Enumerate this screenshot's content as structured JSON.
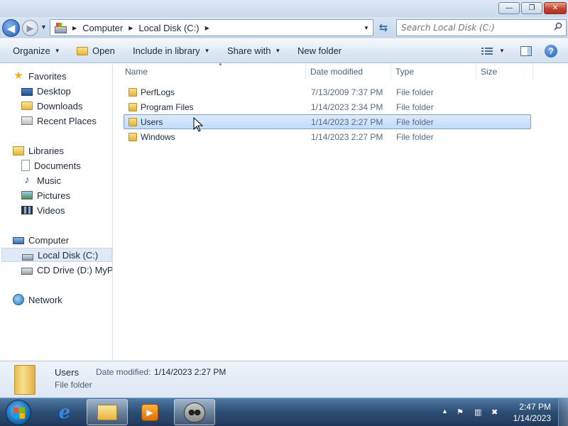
{
  "window": {
    "minimize_label": "—",
    "maximize_label": "❐",
    "close_label": "✕"
  },
  "navbar": {
    "breadcrumbs": [
      "Computer",
      "Local Disk (C:)"
    ],
    "search_placeholder": "Search Local Disk (C:)"
  },
  "toolbar": {
    "organize_label": "Organize",
    "open_label": "Open",
    "include_label": "Include in library",
    "share_label": "Share with",
    "new_folder_label": "New folder"
  },
  "navpane": {
    "favorites": {
      "label": "Favorites",
      "items": [
        "Desktop",
        "Downloads",
        "Recent Places"
      ]
    },
    "libraries": {
      "label": "Libraries",
      "items": [
        "Documents",
        "Music",
        "Pictures",
        "Videos"
      ]
    },
    "computer": {
      "label": "Computer",
      "items": [
        "Local Disk (C:)",
        "CD Drive (D:) MyPal"
      ]
    },
    "network": {
      "label": "Network"
    },
    "selected": "Local Disk (C:)"
  },
  "filelist": {
    "columns": [
      "Name",
      "Date modified",
      "Type",
      "Size"
    ],
    "rows": [
      {
        "name": "PerfLogs",
        "date": "7/13/2009 7:37 PM",
        "type": "File folder"
      },
      {
        "name": "Program Files",
        "date": "1/14/2023 2:34 PM",
        "type": "File folder"
      },
      {
        "name": "Users",
        "date": "1/14/2023 2:27 PM",
        "type": "File folder"
      },
      {
        "name": "Windows",
        "date": "1/14/2023 2:27 PM",
        "type": "File folder"
      }
    ],
    "selected_row": "Users"
  },
  "details": {
    "name": "Users",
    "date_label": "Date modified:",
    "date_value": "1/14/2023 2:27 PM",
    "type": "File folder"
  },
  "taskbar": {
    "clock_time": "2:47 PM",
    "clock_date": "1/14/2023",
    "pinned": [
      "internet-explorer",
      "windows-explorer",
      "media-player",
      "raccoon-app"
    ],
    "active": "windows-explorer"
  },
  "colors": {
    "selection": "#c1dcfc",
    "taskbar": "#2d4d73",
    "accent": "#245fb0"
  }
}
